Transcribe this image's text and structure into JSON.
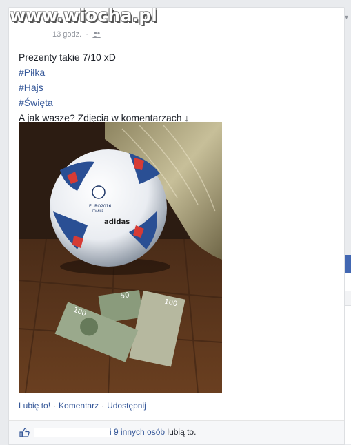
{
  "watermark": "www.wiocha.pl",
  "post": {
    "timestamp": "13 godz.",
    "audience_icon": "friends-icon",
    "lines": {
      "line1": "Prezenty takie 7/10 xD",
      "tag1": "#Piłka",
      "tag2": "#Hajs",
      "tag3": "#Święta",
      "line2": "A jak wasze? Zdjęcia w komentarzach ↓"
    },
    "photo": {
      "ball_brand": "adidas",
      "ball_logo": "EURO2016",
      "ball_logo_sub": "FRANCE",
      "banknote_values": [
        "100",
        "50",
        "100"
      ]
    }
  },
  "actions": {
    "like": "Lubię to!",
    "sep": "·",
    "comment": "Komentarz",
    "share": "Udostępnij"
  },
  "likes": {
    "icon": "thumbs-up-icon",
    "others": "i 9 innych osób",
    "suffix": "lubią to."
  },
  "colors": {
    "link": "#365899",
    "page_bg": "#e9ebee",
    "card_bg": "#ffffff",
    "meta": "#90949c"
  }
}
